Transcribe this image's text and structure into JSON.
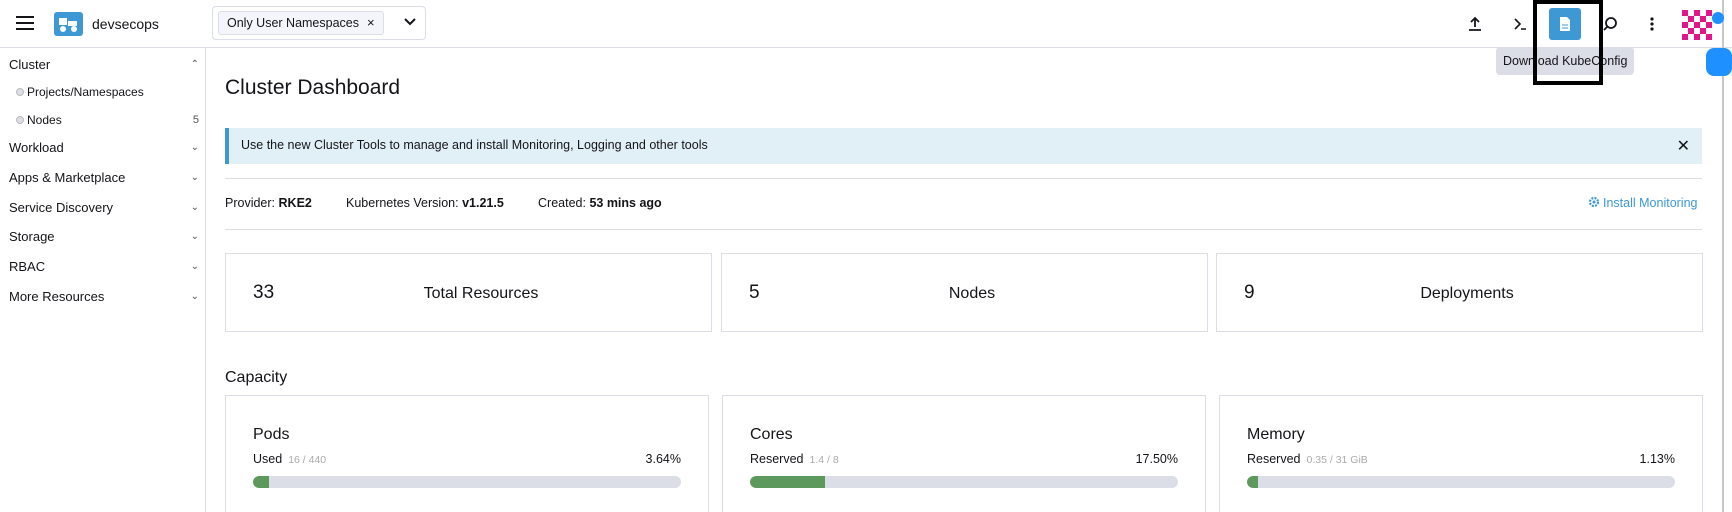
{
  "header": {
    "brand": "devsecops",
    "namespace_filter": "Only User Namespaces",
    "namespace_remove": "×",
    "tooltip": "Download KubeConfig"
  },
  "icons": {
    "menu": "hamburger-icon",
    "logo": "cluster-logo-icon",
    "upload": "upload-icon",
    "shell": "kubectl-shell-icon",
    "kubeconfig": "file-icon",
    "search": "search-icon",
    "more": "more-vertical-icon",
    "avatar": "user-avatar"
  },
  "colors": {
    "accent": "#3d98d3",
    "banner_bg": "#e1f0f7",
    "bar_fill": "#5d995d",
    "bar_track": "#dcdee7"
  },
  "sidebar": {
    "cluster": "Cluster",
    "items": [
      {
        "label": "Projects/Namespaces",
        "count": ""
      },
      {
        "label": "Nodes",
        "count": "5"
      }
    ],
    "groups": [
      "Workload",
      "Apps & Marketplace",
      "Service Discovery",
      "Storage",
      "RBAC",
      "More Resources"
    ]
  },
  "main": {
    "title": "Cluster Dashboard",
    "banner": "Use the new Cluster Tools to manage and install Monitoring, Logging and other tools",
    "banner_close": "✕",
    "provider_label": "Provider:",
    "provider": "RKE2",
    "k8s_label": "Kubernetes Version:",
    "k8s_version": "v1.21.5",
    "created_label": "Created:",
    "created": "53 mins ago",
    "install_monitoring": "Install Monitoring",
    "counts": [
      {
        "value": "33",
        "label": "Total Resources"
      },
      {
        "value": "5",
        "label": "Nodes"
      },
      {
        "value": "9",
        "label": "Deployments"
      }
    ],
    "capacity_title": "Capacity",
    "capacity": [
      {
        "name": "Pods",
        "label": "Used",
        "detail": "16 / 440",
        "percent": "3.64%",
        "fraction": 0.0364
      },
      {
        "name": "Cores",
        "label": "Reserved",
        "detail": "1.4 / 8",
        "percent": "17.50%",
        "fraction": 0.175
      },
      {
        "name": "Memory",
        "label": "Reserved",
        "detail": "0.35 / 31 GiB",
        "percent": "1.13%",
        "fraction": 0.0113
      }
    ]
  }
}
